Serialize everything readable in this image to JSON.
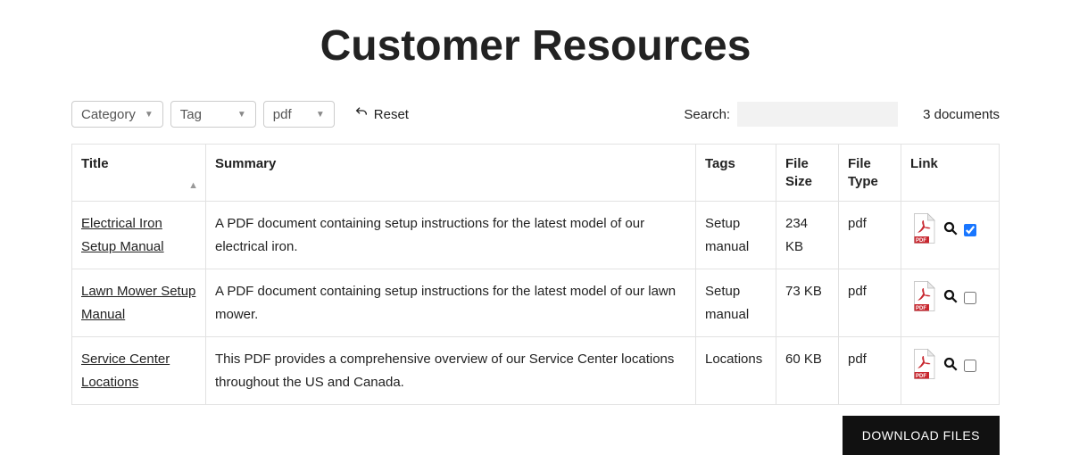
{
  "page": {
    "title": "Customer Resources"
  },
  "filters": {
    "category": {
      "label": "Category"
    },
    "tag": {
      "label": "Tag"
    },
    "filetype": {
      "label": "pdf"
    },
    "reset_label": "Reset",
    "search_label": "Search:",
    "search_value": "",
    "doc_count_text": "3 documents"
  },
  "table": {
    "headers": {
      "title": "Title",
      "summary": "Summary",
      "tags": "Tags",
      "file_size": "File Size",
      "file_type": "File Type",
      "link": "Link"
    },
    "rows": [
      {
        "title": "Electrical Iron Setup Manual",
        "summary": "A PDF document containing setup instructions for the latest model of our electrical iron.",
        "tags": "Setup manual",
        "file_size": "234 KB",
        "file_type": "pdf",
        "selected": true
      },
      {
        "title": "Lawn Mower Setup Manual",
        "summary": "A PDF document containing setup instructions for the latest model of our lawn mower.",
        "tags": "Setup manual",
        "file_size": "73 KB",
        "file_type": "pdf",
        "selected": false
      },
      {
        "title": "Service Center Locations",
        "summary": "This PDF provides a comprehensive overview of our Service Center locations throughout the US and Canada.",
        "tags": "Locations",
        "file_size": "60 KB",
        "file_type": "pdf",
        "selected": false
      }
    ]
  },
  "actions": {
    "download_label": "DOWNLOAD FILES"
  }
}
